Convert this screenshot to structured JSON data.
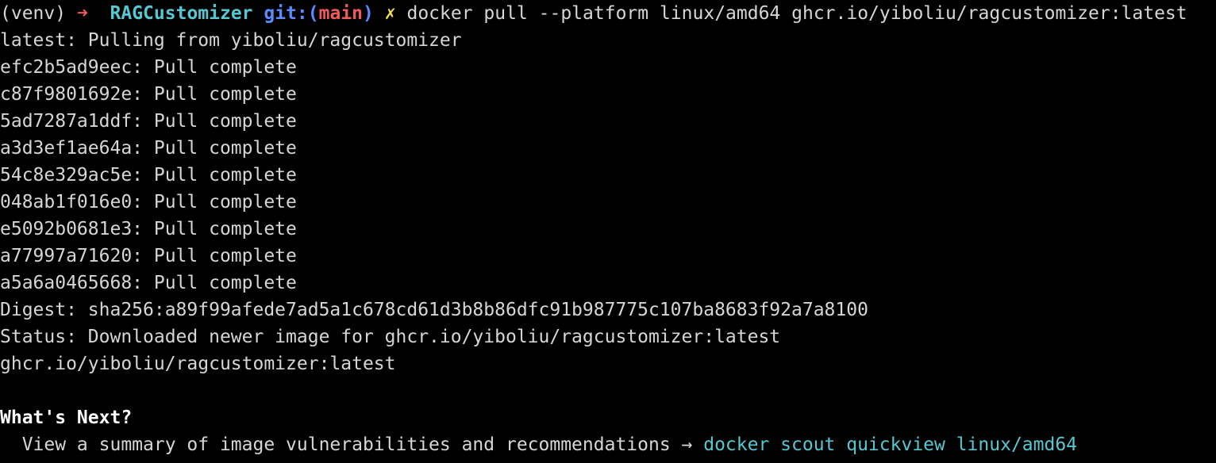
{
  "prompt": {
    "venv": "(venv)",
    "arrow": "➜",
    "directory": "RAGCustomizer",
    "git_prefix": "git:(",
    "branch": "main",
    "git_suffix": ")",
    "dirty_mark": "✗",
    "command": "docker pull --platform linux/amd64 ghcr.io/yiboliu/ragcustomizer:latest"
  },
  "output": {
    "pulling": "latest: Pulling from yiboliu/ragcustomizer",
    "layers": [
      "efc2b5ad9eec: Pull complete",
      "c87f9801692e: Pull complete",
      "5ad7287a1ddf: Pull complete",
      "a3d3ef1ae64a: Pull complete",
      "54c8e329ac5e: Pull complete",
      "048ab1f016e0: Pull complete",
      "e5092b0681e3: Pull complete",
      "a77997a71620: Pull complete",
      "a5a6a0465668: Pull complete"
    ],
    "digest": "Digest: sha256:a89f99afede7ad5a1c678cd61d3b8b86dfc91b987775c107ba8683f92a7a8100",
    "status": "Status: Downloaded newer image for ghcr.io/yiboliu/ragcustomizer:latest",
    "image_ref": "ghcr.io/yiboliu/ragcustomizer:latest"
  },
  "whats_next": {
    "heading": "What's Next?",
    "summary_text": "  View a summary of image vulnerabilities and recommendations → ",
    "summary_command": "docker scout quickview linux/amd64"
  },
  "colors": {
    "background": "#000000",
    "text": "#d6d6d6",
    "accent_cyan": "#57c7d1",
    "accent_red": "#ef5b5b",
    "accent_blue": "#5b8cff",
    "accent_yellow": "#f3e35a"
  }
}
